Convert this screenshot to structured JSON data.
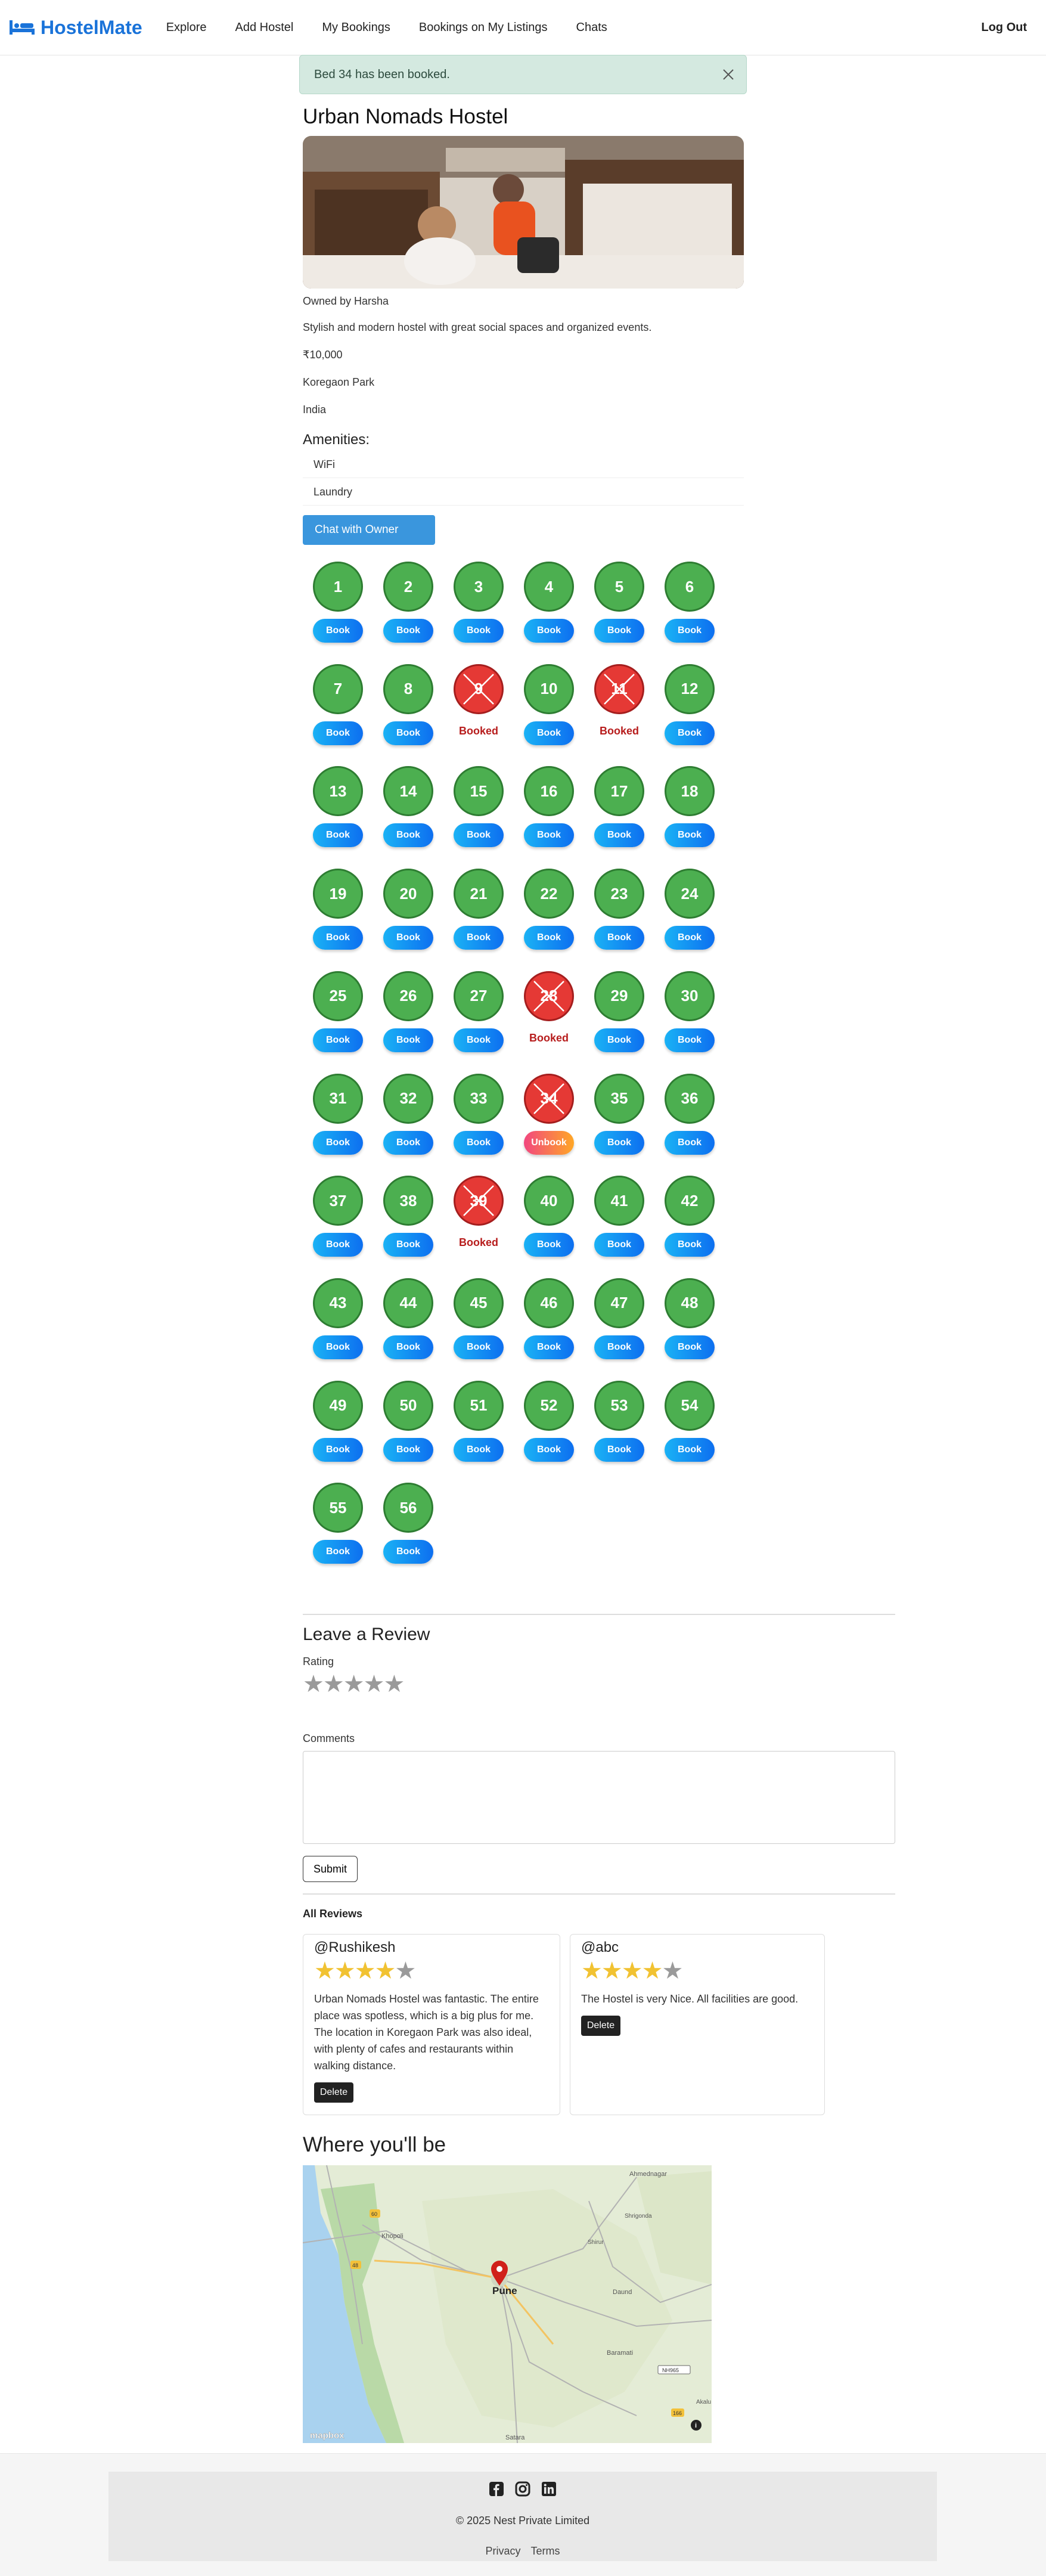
{
  "nav": {
    "brand": "HostelMate",
    "links": [
      "Explore",
      "Add Hostel",
      "My Bookings",
      "Bookings on My Listings",
      "Chats"
    ],
    "logout": "Log Out"
  },
  "alert": {
    "message": "Bed 34 has been booked."
  },
  "listing": {
    "title": "Urban Nomads Hostel",
    "owner": "Owned by Harsha",
    "description": "Stylish and modern hostel with great social spaces and organized events.",
    "price": "₹10,000",
    "location": "Koregaon Park",
    "country": "India",
    "amenities_title": "Amenities:",
    "amenities": [
      "WiFi",
      "Laundry"
    ],
    "chat_button": "Chat with Owner"
  },
  "beds": {
    "book_label": "Book",
    "unbook_label": "Unbook",
    "booked_label": "Booked",
    "total": 56,
    "booked_by_others": [
      9,
      11,
      28,
      39
    ],
    "booked_by_me": [
      34
    ]
  },
  "review_form": {
    "title": "Leave a Review",
    "rating_label": "Rating",
    "comments_label": "Comments",
    "submit": "Submit",
    "star_glyph": "★"
  },
  "reviews": {
    "title": "All Reviews",
    "delete_label": "Delete",
    "items": [
      {
        "user": "@Rushikesh",
        "rating": 4,
        "text": "Urban Nomads Hostel was fantastic. The entire place was spotless, which is a big plus for me. The location in Koregaon Park was also ideal, with plenty of cafes and restaurants within walking distance."
      },
      {
        "user": "@abc",
        "rating": 4,
        "text": "The Hostel is very Nice. All facilities are good."
      }
    ]
  },
  "map": {
    "title": "Where you'll be",
    "places": [
      "Ahmednagar",
      "Khopoli",
      "Pune",
      "Shirur",
      "Daund",
      "Baramati",
      "Satara",
      "Shrigonda",
      "Akalu"
    ],
    "roads": [
      "60",
      "48",
      "NH965",
      "166"
    ],
    "attribution": "mapbox",
    "info": "i"
  },
  "footer": {
    "copyright": "© 2025 Nest Private Limited",
    "links": [
      "Privacy",
      "Terms"
    ],
    "social": [
      "facebook-icon",
      "instagram-icon",
      "linkedin-icon"
    ]
  }
}
